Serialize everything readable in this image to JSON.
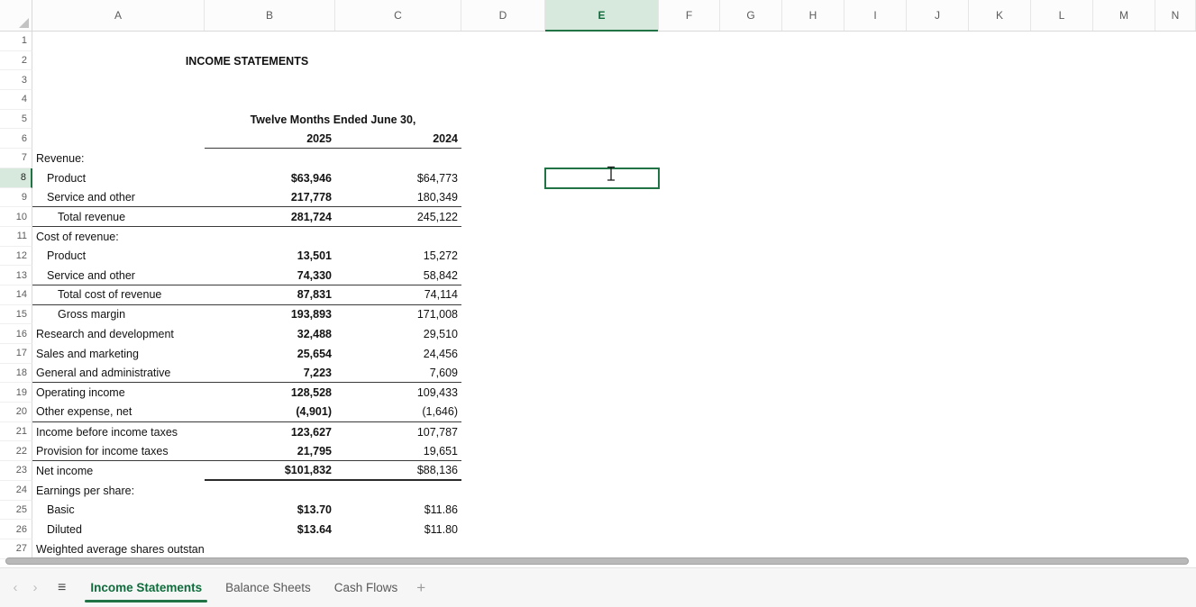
{
  "sheet": {
    "column_labels": [
      "A",
      "B",
      "C",
      "D",
      "E",
      "F",
      "G",
      "H",
      "I",
      "J",
      "K",
      "L",
      "M",
      "N"
    ],
    "selected_column": "E",
    "selected_row": 8,
    "selected_cell": "E8",
    "rows": [
      {},
      {
        "title": "INCOME STATEMENTS"
      },
      {},
      {},
      {
        "subtitle": "Twelve Months Ended June 30,"
      },
      {
        "b": "2025",
        "c": "2024",
        "c_bold": true,
        "border": "bc"
      },
      {
        "a": "Revenue:"
      },
      {
        "a": "Product",
        "ind": 1,
        "b": "$63,946",
        "c": "$64,773"
      },
      {
        "a": "Service and other",
        "ind": 1,
        "b": "217,778",
        "c": "180,349",
        "border": "abc"
      },
      {
        "a": "Total revenue",
        "ind": 2,
        "b": "281,724",
        "c": "245,122",
        "border": "abc"
      },
      {
        "a": "Cost of revenue:"
      },
      {
        "a": "Product",
        "ind": 1,
        "b": "13,501",
        "c": "15,272"
      },
      {
        "a": "Service and other",
        "ind": 1,
        "b": "74,330",
        "c": "58,842",
        "border": "abc"
      },
      {
        "a": "Total cost of revenue",
        "ind": 2,
        "b": "87,831",
        "c": "74,114",
        "border": "abc"
      },
      {
        "a": "Gross margin",
        "ind": 2,
        "b": "193,893",
        "c": "171,008"
      },
      {
        "a": "Research and development",
        "b": "32,488",
        "c": "29,510"
      },
      {
        "a": "Sales and marketing",
        "b": "25,654",
        "c": "24,456"
      },
      {
        "a": "General and administrative",
        "b": "7,223",
        "c": "7,609",
        "border": "abc"
      },
      {
        "a": "Operating income",
        "b": "128,528",
        "c": "109,433"
      },
      {
        "a": "Other expense, net",
        "b": "(4,901)",
        "c": "(1,646)",
        "border": "abc"
      },
      {
        "a": "Income before income taxes",
        "b": "123,627",
        "c": "107,787"
      },
      {
        "a": "Provision for income taxes",
        "b": "21,795",
        "c": "19,651",
        "border": "abc"
      },
      {
        "a": "Net income",
        "b": "$101,832",
        "c": "$88,136",
        "border": "bc-strong"
      },
      {
        "a": "Earnings per share:"
      },
      {
        "a": "Basic",
        "ind": 1,
        "b": "$13.70",
        "c": "$11.86"
      },
      {
        "a": "Diluted",
        "ind": 1,
        "b": "$13.64",
        "c": "$11.80"
      },
      {
        "a": "Weighted average shares outstanding:"
      }
    ]
  },
  "tabbar": {
    "nav_prev": "‹",
    "nav_next": "›",
    "menu_icon": "≡",
    "tabs": [
      "Income Statements",
      "Balance Sheets",
      "Cash Flows"
    ],
    "active_tab": "Income Statements",
    "add_label": "+"
  },
  "colors": {
    "accent_green": "#217346",
    "selected_header_fill": "#d7e9dd",
    "active_tab_text": "#0f6b3c"
  }
}
